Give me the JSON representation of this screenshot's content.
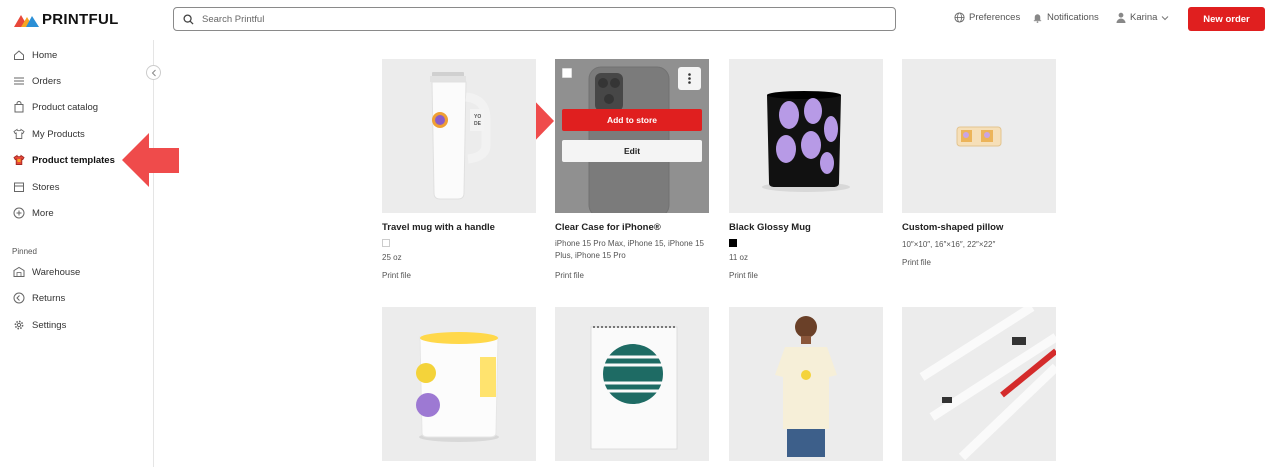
{
  "header": {
    "logo_text": "PRINTFUL",
    "search_placeholder": "Search Printful",
    "preferences": "Preferences",
    "notifications": "Notifications",
    "user_name": "Karina",
    "new_order": "New order"
  },
  "sidebar": {
    "items": [
      {
        "label": "Home",
        "icon": "home-icon"
      },
      {
        "label": "Orders",
        "icon": "list-icon"
      },
      {
        "label": "Product catalog",
        "icon": "bag-icon"
      },
      {
        "label": "My Products",
        "icon": "tshirt-icon"
      },
      {
        "label": "Product templates",
        "icon": "tshirt-color-icon",
        "active": true
      },
      {
        "label": "Stores",
        "icon": "store-icon"
      },
      {
        "label": "More",
        "icon": "plus-circle-icon"
      }
    ],
    "pinned_label": "Pinned",
    "pinned_items": [
      {
        "label": "Warehouse",
        "icon": "warehouse-icon"
      },
      {
        "label": "Returns",
        "icon": "return-icon"
      },
      {
        "label": "Settings",
        "icon": "gear-icon"
      }
    ]
  },
  "products": [
    {
      "name": "Travel mug with a handle",
      "desc": "25 oz",
      "swatch_color": "#ffffff",
      "print_file": "Print file"
    },
    {
      "name": "Clear Case for iPhone®",
      "desc": "iPhone 15 Pro Max, iPhone 15, iPhone 15 Plus, iPhone 15 Pro",
      "print_file": "Print file",
      "hovered": true,
      "add_to_store": "Add to store",
      "edit": "Edit"
    },
    {
      "name": "Black Glossy Mug",
      "desc": "11 oz",
      "swatch_color": "#000000",
      "print_file": "Print file"
    },
    {
      "name": "Custom-shaped pillow",
      "desc": "10″×10″, 16″×16″, 22″×22″",
      "print_file": "Print file"
    }
  ],
  "colors": {
    "accent": "#e01f1f",
    "arrow": "#ef4b4b",
    "placeholder_bg": "#ececec"
  }
}
